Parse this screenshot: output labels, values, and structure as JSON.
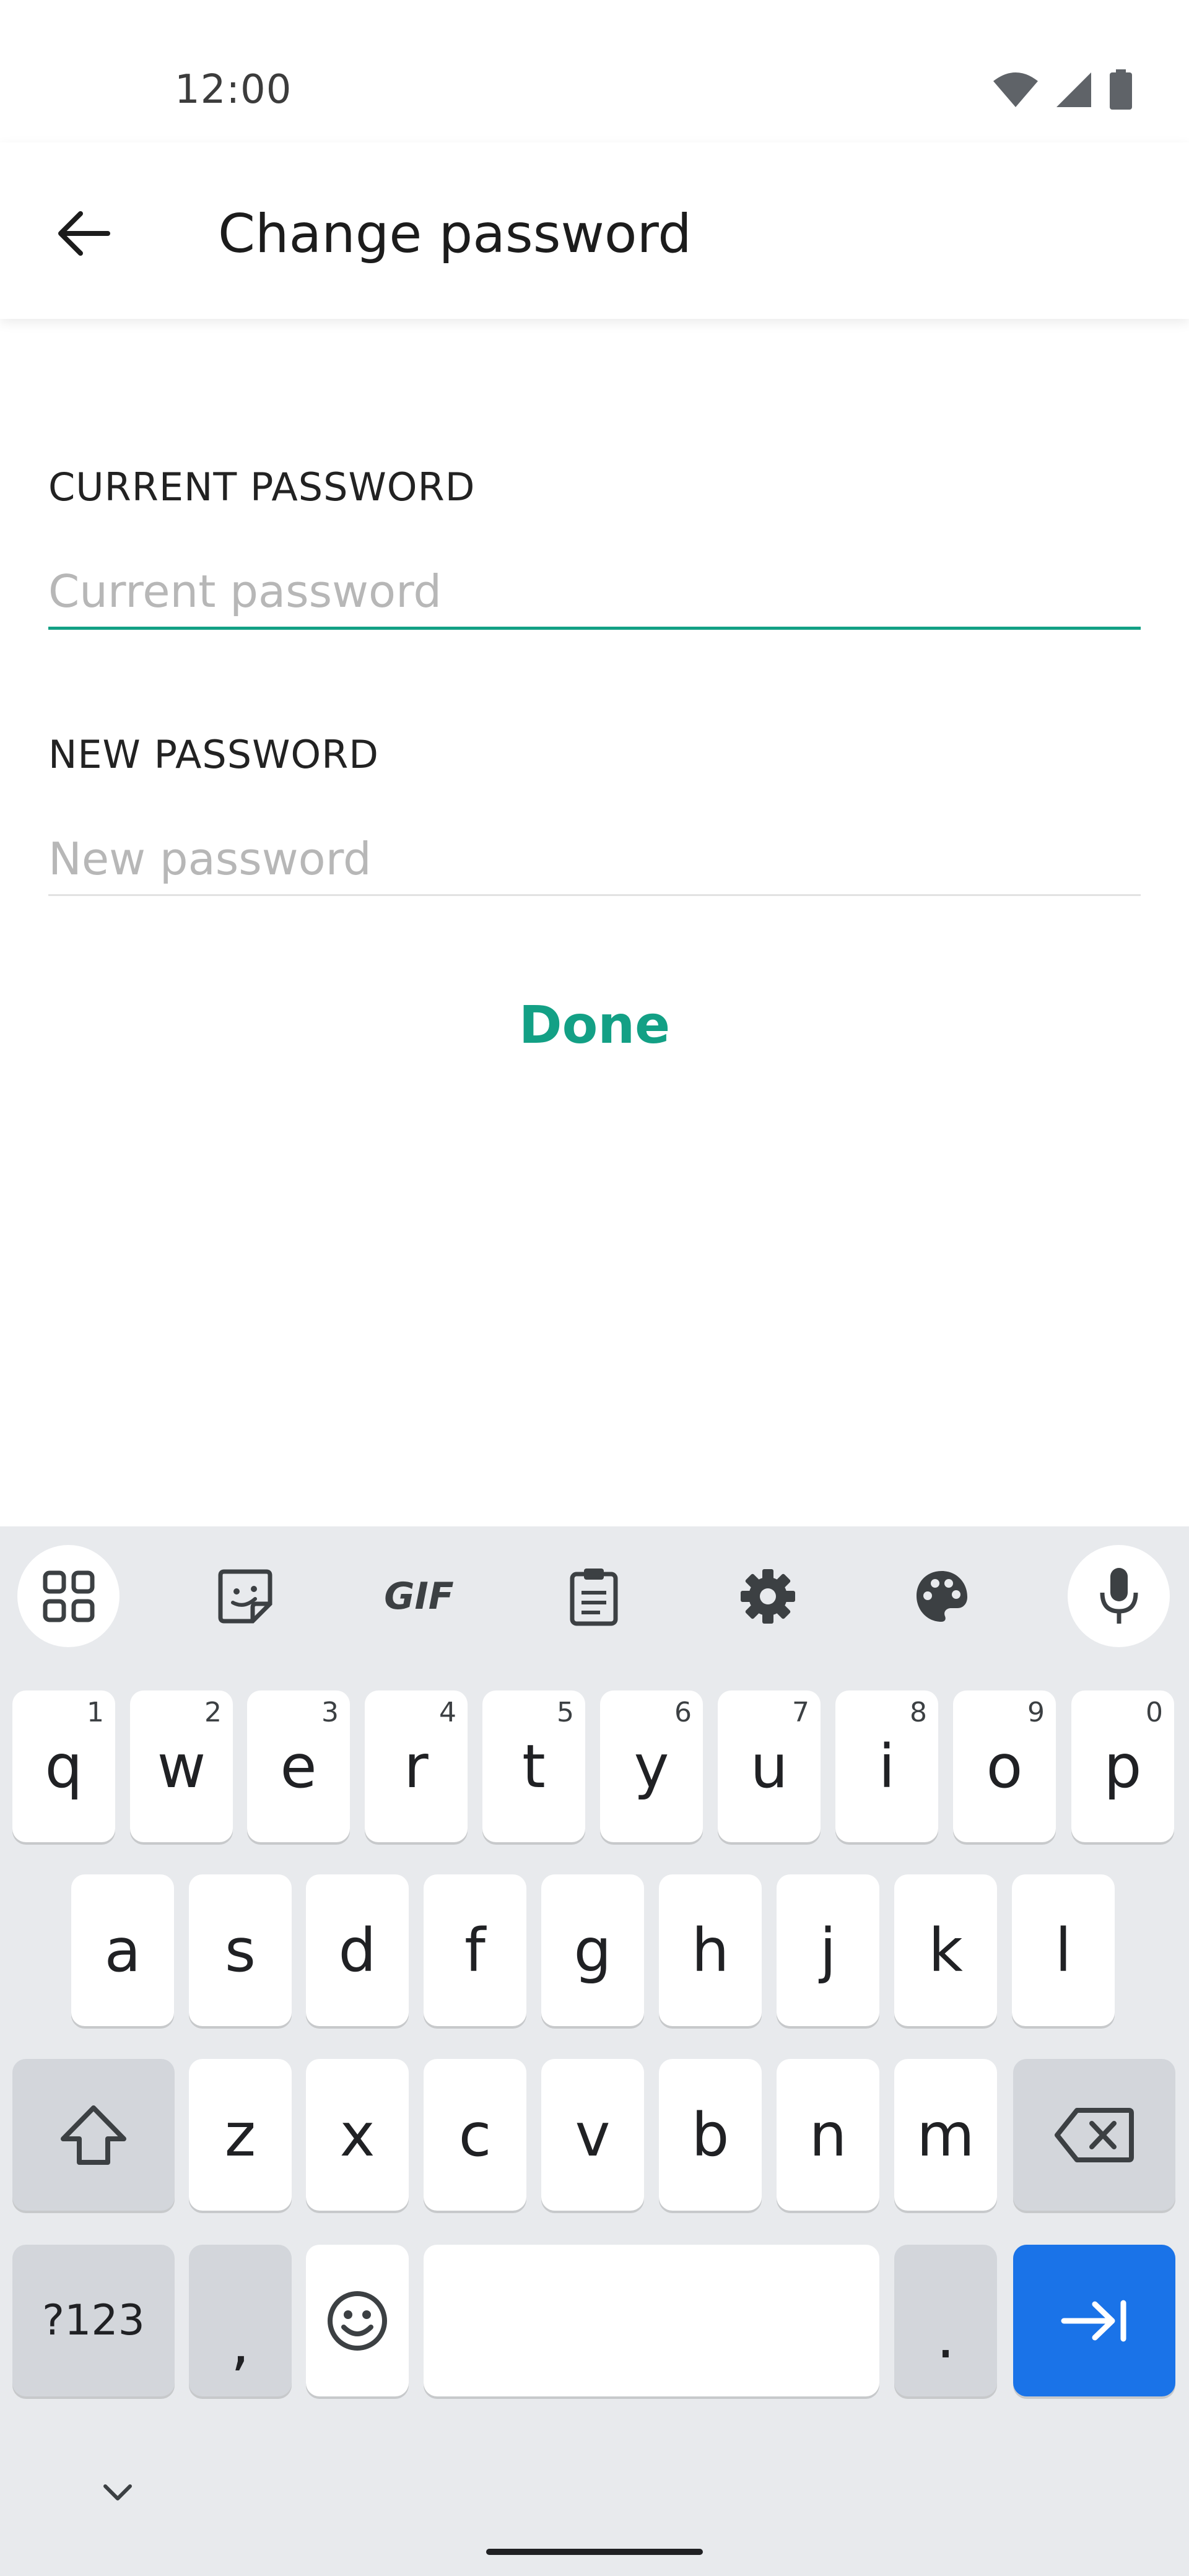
{
  "status_bar": {
    "time": "12:00",
    "icons": [
      "wifi-icon",
      "signal-icon",
      "battery-icon"
    ]
  },
  "app_bar": {
    "title": "Change password",
    "back_icon": "arrow-left-icon"
  },
  "form": {
    "current_password": {
      "label": "CURRENT PASSWORD",
      "placeholder": "Current password",
      "value": ""
    },
    "new_password": {
      "label": "NEW PASSWORD",
      "placeholder": "New password",
      "value": ""
    },
    "done_label": "Done"
  },
  "colors": {
    "accent": "#13a085",
    "keyboard_bg": "#e8eaed",
    "enter_key": "#1a73e8"
  },
  "keyboard": {
    "toolbar": [
      "apps-grid-icon",
      "sticker-icon",
      "GIF",
      "clipboard-icon",
      "settings-gear-icon",
      "palette-icon",
      "microphone-icon"
    ],
    "row1": [
      {
        "key": "q",
        "hint": "1"
      },
      {
        "key": "w",
        "hint": "2"
      },
      {
        "key": "e",
        "hint": "3"
      },
      {
        "key": "r",
        "hint": "4"
      },
      {
        "key": "t",
        "hint": "5"
      },
      {
        "key": "y",
        "hint": "6"
      },
      {
        "key": "u",
        "hint": "7"
      },
      {
        "key": "i",
        "hint": "8"
      },
      {
        "key": "o",
        "hint": "9"
      },
      {
        "key": "p",
        "hint": "0"
      }
    ],
    "row2": [
      "a",
      "s",
      "d",
      "f",
      "g",
      "h",
      "j",
      "k",
      "l"
    ],
    "row3": [
      "z",
      "x",
      "c",
      "v",
      "b",
      "n",
      "m"
    ],
    "bottom": {
      "symbols": "?123",
      "comma": ",",
      "period": "."
    }
  }
}
